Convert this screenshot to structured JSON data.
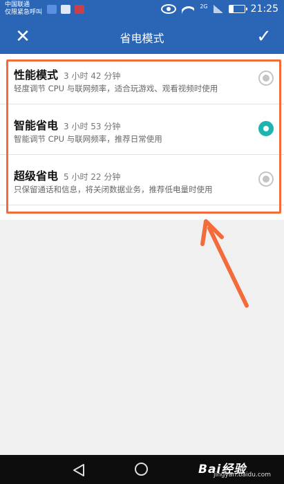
{
  "statusbar": {
    "carrier_line1": "中国联通",
    "carrier_line2": "仅限紧急呼叫",
    "network_badge": "2G",
    "time": "21:25",
    "icons": [
      "notification-heart-icon",
      "notification-app-icon",
      "notification-red-app-icon",
      "eye-icon",
      "wifi-icon",
      "no-signal-icon",
      "battery-icon"
    ]
  },
  "header": {
    "title": "省电模式",
    "close_label": "✕",
    "confirm_label": "✓"
  },
  "modes": [
    {
      "name": "性能模式",
      "time": "3 小时 42 分钟",
      "desc": "轻度调节 CPU 与联网频率，适合玩游戏、观看视频时使用",
      "selected": false
    },
    {
      "name": "智能省电",
      "time": "3 小时 53 分钟",
      "desc": "智能调节 CPU 与联网频率，推荐日常使用",
      "selected": true
    },
    {
      "name": "超级省电",
      "time": "5 小时 22 分钟",
      "desc": "只保留通话和信息，将关闭数据业务，推荐低电量时使用",
      "selected": false
    }
  ],
  "annotation_color": "#f36b3b",
  "accent_color": "#1fb4b0",
  "header_color": "#2a65b6",
  "watermark": {
    "logo": "Bai经验",
    "url": "jingyan.baidu.com"
  }
}
